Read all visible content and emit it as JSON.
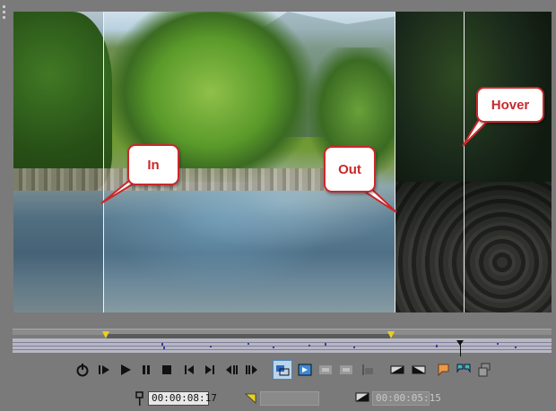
{
  "callouts": {
    "in": "In",
    "out": "Out",
    "hover": "Hover"
  },
  "fields": {
    "in_time": "00:00:08:17",
    "out_time": "",
    "length": "00:00:05:15"
  },
  "icons": {
    "loop": "loop-icon",
    "play_from_start": "play-from-start-icon",
    "play": "play-icon",
    "pause": "pause-icon",
    "stop": "stop-icon",
    "prev_frame": "previous-frame-icon",
    "next_frame": "next-frame-icon",
    "mark_in": "mark-in-icon",
    "mark_out": "mark-out-icon"
  },
  "colors": {
    "callout_border": "#c8292b",
    "active_button": "#bcd4ea",
    "region_flag": "#e8d020"
  }
}
